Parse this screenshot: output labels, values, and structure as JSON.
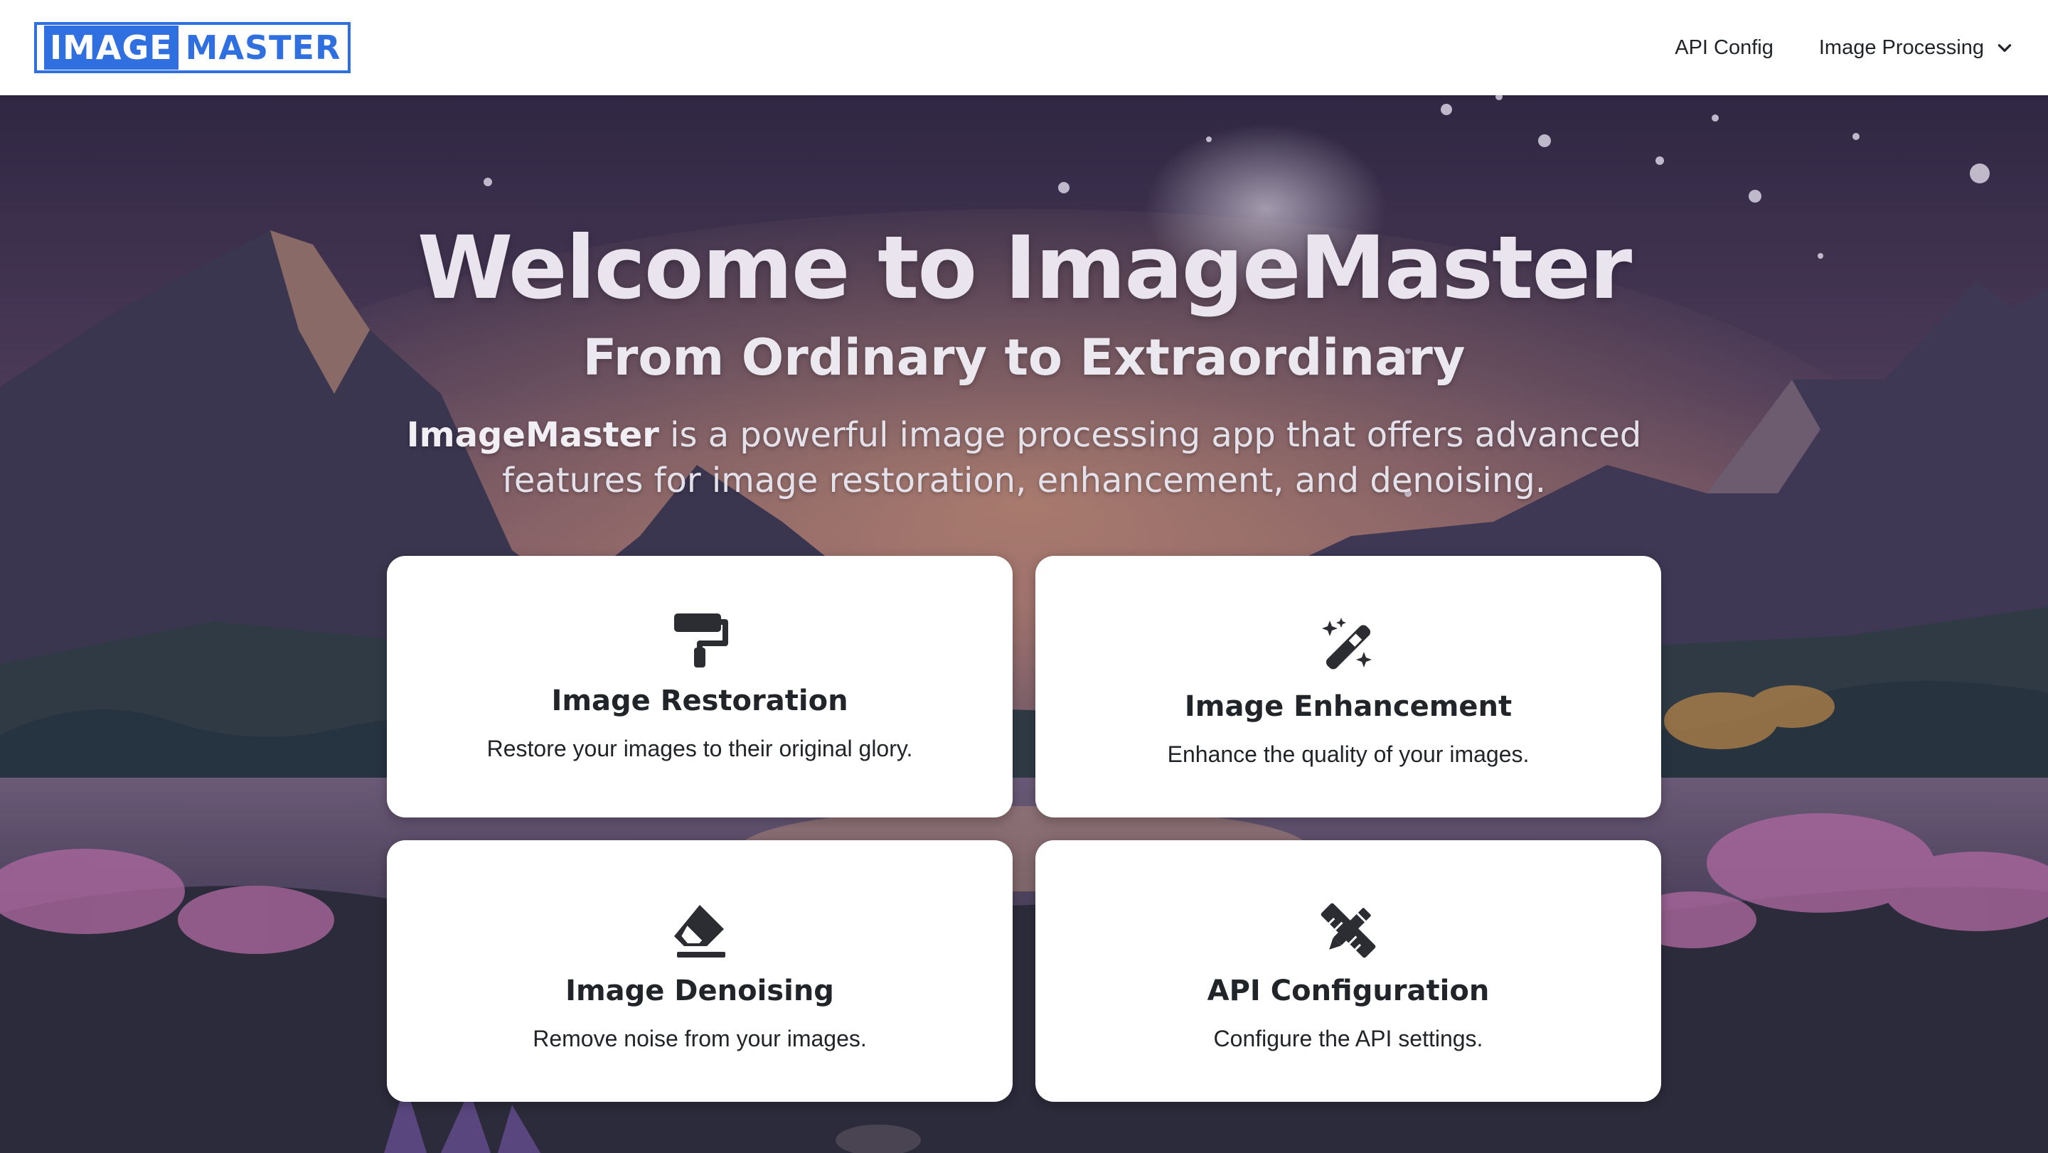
{
  "navbar": {
    "logo": {
      "part1": "IMAGE",
      "part2": "MASTER"
    },
    "links": [
      {
        "label": "API Config",
        "icon": null
      },
      {
        "label": "Image Processing",
        "icon": "chevron-down-icon"
      }
    ]
  },
  "hero": {
    "title": "Welcome to ImageMaster",
    "subtitle": "From Ordinary to Extraordinary",
    "description_bold": "ImageMaster",
    "description_rest": " is a powerful image processing app that offers advanced features for image restoration, enhancement, and denoising."
  },
  "cards": [
    {
      "title": "Image Restoration",
      "description": "Restore your images to their original glory.",
      "icon": "paint-roller-icon"
    },
    {
      "title": "Image Enhancement",
      "description": "Enhance the quality of your images.",
      "icon": "magic-wand-sparkles-icon"
    },
    {
      "title": "Image Denoising",
      "description": "Remove noise from your images.",
      "icon": "eraser-icon"
    },
    {
      "title": "API Configuration",
      "description": "Configure the API settings.",
      "icon": "pencil-ruler-icon"
    }
  ],
  "colors": {
    "brand": "#2f6fe0",
    "card_text": "#212529",
    "nav_bg": "#ffffff"
  }
}
